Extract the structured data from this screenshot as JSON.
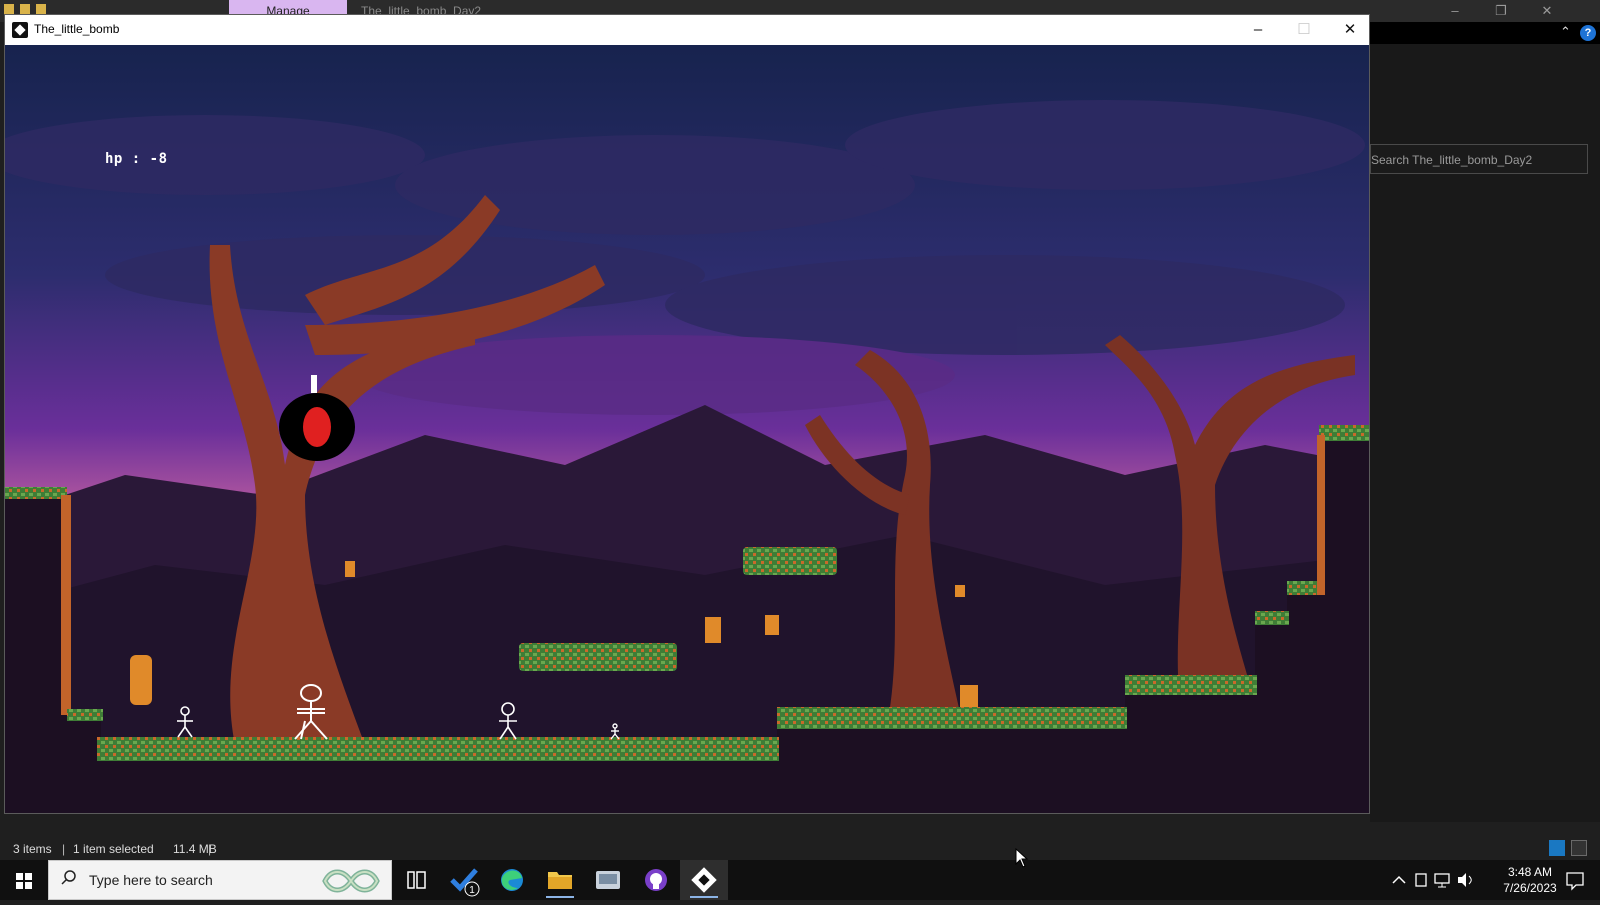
{
  "explorer": {
    "manage_tab": "Manage",
    "context_title": "The_little_bomb_Day2",
    "search_placeholder": "Search The_little_bomb_Day2",
    "status": {
      "items": "3 items",
      "selected": "1 item selected",
      "size": "11.4 MB"
    }
  },
  "game_window": {
    "title": "The_little_bomb",
    "minimize": "–",
    "maximize": "☐",
    "close": "✕",
    "hud": {
      "hp_label": "hp  :  -8"
    },
    "entities": [
      "bomb-player",
      "stick-figure-enemy",
      "stick-figure-enemy",
      "stick-figure-enemy",
      "stick-figure-enemy"
    ]
  },
  "taskbar": {
    "search_placeholder": "Type here to search",
    "apps": [
      {
        "name": "task-view-icon"
      },
      {
        "name": "todo-icon",
        "badge": "1"
      },
      {
        "name": "edge-icon"
      },
      {
        "name": "file-explorer-icon"
      },
      {
        "name": "media-icon"
      },
      {
        "name": "github-desktop-icon"
      },
      {
        "name": "game-app-icon"
      }
    ],
    "clock": {
      "time": "3:48 AM",
      "date": "7/26/2023"
    }
  },
  "colors": {
    "sky_top": "#1c2a5a",
    "sky_mid": "#6b2f9a",
    "ground_grass": "#4c8a3a",
    "ground_dirt": "#c2642a",
    "bomb_body": "#000000",
    "bomb_core": "#e02020",
    "hp_text": "#ffffff"
  }
}
